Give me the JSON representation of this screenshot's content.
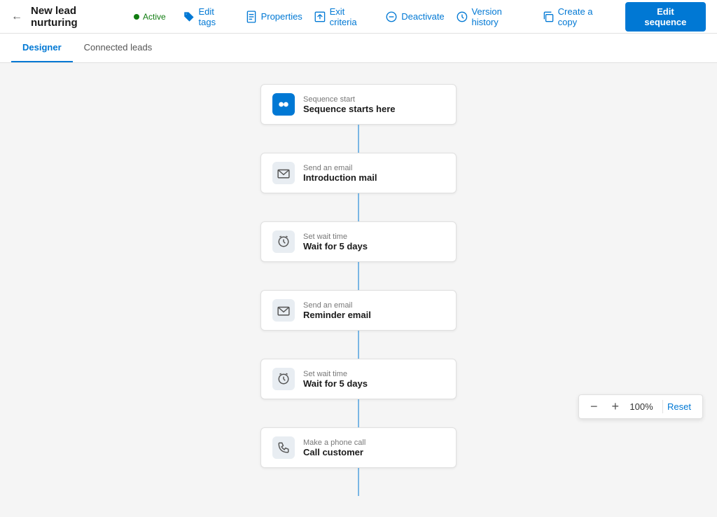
{
  "header": {
    "back_label": "←",
    "title": "New lead nurturing",
    "status_label": "Active",
    "actions": [
      {
        "id": "edit-tags",
        "label": "Edit tags",
        "icon": "tag-icon"
      },
      {
        "id": "properties",
        "label": "Properties",
        "icon": "document-icon"
      },
      {
        "id": "exit-criteria",
        "label": "Exit criteria",
        "icon": "exit-icon"
      },
      {
        "id": "deactivate",
        "label": "Deactivate",
        "icon": "deactivate-icon"
      },
      {
        "id": "version-history",
        "label": "Version history",
        "icon": "history-icon"
      },
      {
        "id": "create-copy",
        "label": "Create a copy",
        "icon": "copy-icon"
      }
    ],
    "edit_sequence_label": "Edit sequence"
  },
  "tabs": [
    {
      "id": "designer",
      "label": "Designer",
      "active": true
    },
    {
      "id": "connected-leads",
      "label": "Connected leads",
      "active": false
    }
  ],
  "sequence_nodes": [
    {
      "id": "start",
      "icon_type": "blue-bg",
      "icon": "sequence-icon",
      "label": "Sequence start",
      "title": "Sequence starts here"
    },
    {
      "id": "email-1",
      "icon_type": "gray-bg",
      "icon": "email-icon",
      "label": "Send an email",
      "title": "Introduction mail"
    },
    {
      "id": "wait-1",
      "icon_type": "gray-bg",
      "icon": "wait-icon",
      "label": "Set wait time",
      "title": "Wait for 5 days"
    },
    {
      "id": "email-2",
      "icon_type": "gray-bg",
      "icon": "email-icon",
      "label": "Send an email",
      "title": "Reminder email"
    },
    {
      "id": "wait-2",
      "icon_type": "gray-bg",
      "icon": "wait-icon",
      "label": "Set wait time",
      "title": "Wait for 5 days"
    },
    {
      "id": "phone-1",
      "icon_type": "gray-bg",
      "icon": "phone-icon",
      "label": "Make a phone call",
      "title": "Call customer"
    }
  ],
  "zoom": {
    "minus_label": "−",
    "plus_label": "+",
    "value": "100%",
    "reset_label": "Reset"
  }
}
